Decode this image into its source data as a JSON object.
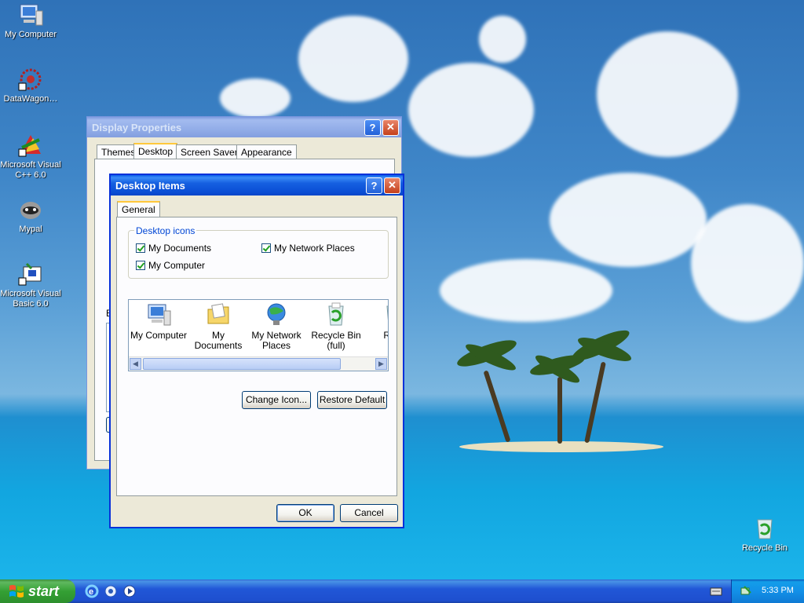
{
  "desktop": {
    "icons": [
      {
        "label": "My Computer",
        "icon": "my-computer-icon"
      },
      {
        "label": "DataWagon…",
        "icon": "datawagon-icon"
      },
      {
        "label": "Microsoft Visual C++ 6.0",
        "icon": "visual-cpp-icon"
      },
      {
        "label": "Mypal",
        "icon": "mypal-icon"
      },
      {
        "label": "Microsoft Visual Basic 6.0",
        "icon": "visual-basic-icon"
      }
    ],
    "recycle_bin": {
      "label": "Recycle Bin",
      "icon": "recycle-bin-icon"
    }
  },
  "display_properties": {
    "title": "Display Properties",
    "tabs": [
      "Themes",
      "Desktop",
      "Screen Saver",
      "Appearance"
    ],
    "active_tab": "Desktop",
    "partial_label": "B"
  },
  "desktop_items": {
    "title": "Desktop Items",
    "tab": "General",
    "group_label": "Desktop icons",
    "checkboxes": [
      {
        "label": "My Documents",
        "checked": true
      },
      {
        "label": "My Network Places",
        "checked": true
      },
      {
        "label": "My Computer",
        "checked": true
      }
    ],
    "icon_list": [
      {
        "label": "My Computer",
        "icon": "my-computer-icon"
      },
      {
        "label": "My Documents",
        "icon": "my-documents-icon"
      },
      {
        "label": "My Network Places",
        "icon": "network-places-icon"
      },
      {
        "label": "Recycle Bin (full)",
        "icon": "recycle-bin-full-icon"
      },
      {
        "label": "Re…",
        "icon": "recycle-bin-empty-icon"
      }
    ],
    "change_icon_label": "Change Icon...",
    "restore_default_label": "Restore Default",
    "ok_label": "OK",
    "cancel_label": "Cancel"
  },
  "taskbar": {
    "start_label": "start",
    "quicklaunch": [
      "ie-icon",
      "media-icon",
      "windows-media-player-icon"
    ],
    "clock": "5:33 PM"
  },
  "colors": {
    "title_active": "#0a58e4",
    "dialog_bg": "#ece9d8",
    "taskbar": "#245edb",
    "start_green": "#34a034"
  }
}
